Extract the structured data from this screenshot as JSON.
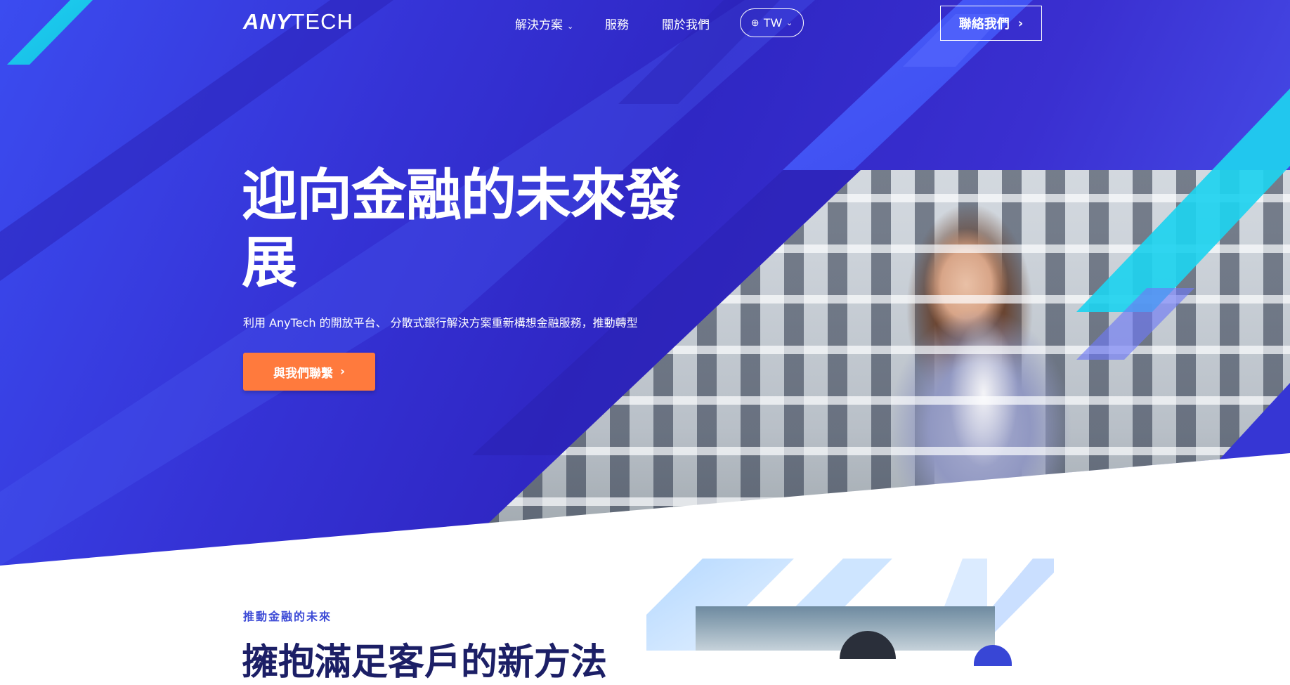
{
  "brand": {
    "logo_any": "ANY",
    "logo_tech": "TECH"
  },
  "nav": {
    "items": [
      {
        "label": "解決方案",
        "has_dropdown": true
      },
      {
        "label": "服務",
        "has_dropdown": false
      },
      {
        "label": "關於我們",
        "has_dropdown": false
      }
    ],
    "language": "TW",
    "contact_button": "聯絡我們"
  },
  "hero": {
    "title_line1": "迎向金融的未來發",
    "title_line2": "展",
    "subtitle": "利用 AnyTech 的開放平台、 分散式銀行解決方案重新構想金融服務，推動轉型",
    "cta_label": "與我們聯繫",
    "cta_color": "#ff7a3d"
  },
  "section": {
    "eyebrow": "推動金融的未來",
    "title": "擁抱滿足客戶的新方法"
  },
  "colors": {
    "hero_bg": "#3533d6",
    "accent_cyan": "#1ed3ef",
    "accent_orange": "#ff7a3d",
    "heading_dark": "#1c1f66",
    "eyebrow_blue": "#3d4bd6"
  },
  "icons": {
    "dropdown": "chevron-down-icon",
    "language": "globe-icon",
    "contact_arrow": "chevron-right-icon",
    "cta_arrow": "chevron-right-icon"
  }
}
